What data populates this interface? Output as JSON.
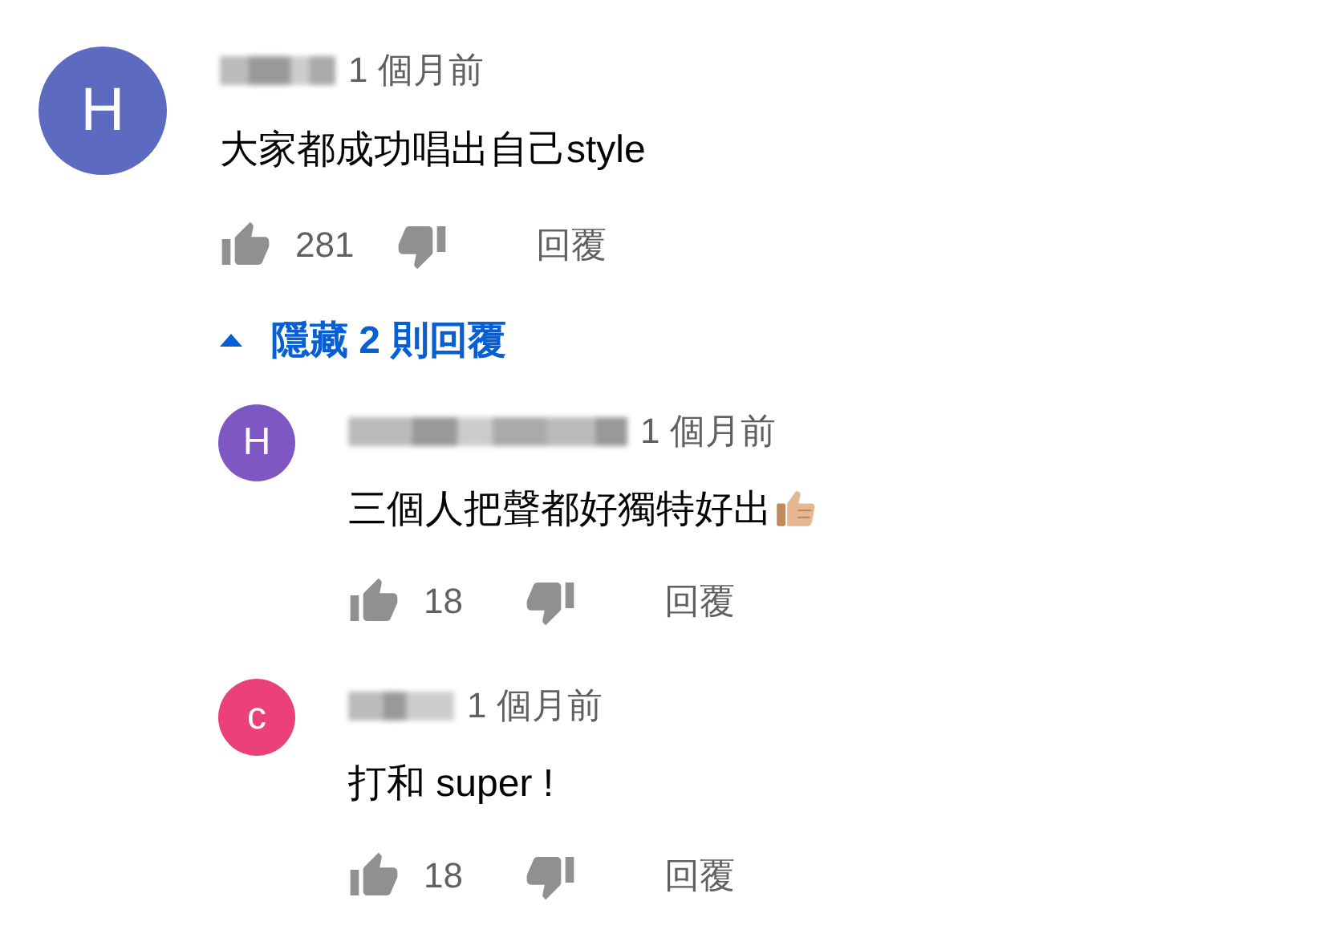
{
  "comment": {
    "letter": "H",
    "color": "#5c6bc0",
    "time": "1 個月前",
    "text": "大家都成功唱出自己style",
    "likes": "281",
    "reply_label": "回覆"
  },
  "replies_toggle": {
    "expanded": true,
    "label": "隱藏 2 則回覆"
  },
  "replies": [
    {
      "letter": "H",
      "color": "#7e57c2",
      "time": "1 個月前",
      "text": "三個人把聲都好獨特好出",
      "thumbs_up_emoji": true,
      "likes": "18",
      "reply_label": "回覆"
    },
    {
      "letter": "c",
      "color": "#ec407a",
      "time": "1 個月前",
      "text": "打和 super !",
      "likes": "18",
      "reply_label": "回覆"
    }
  ]
}
